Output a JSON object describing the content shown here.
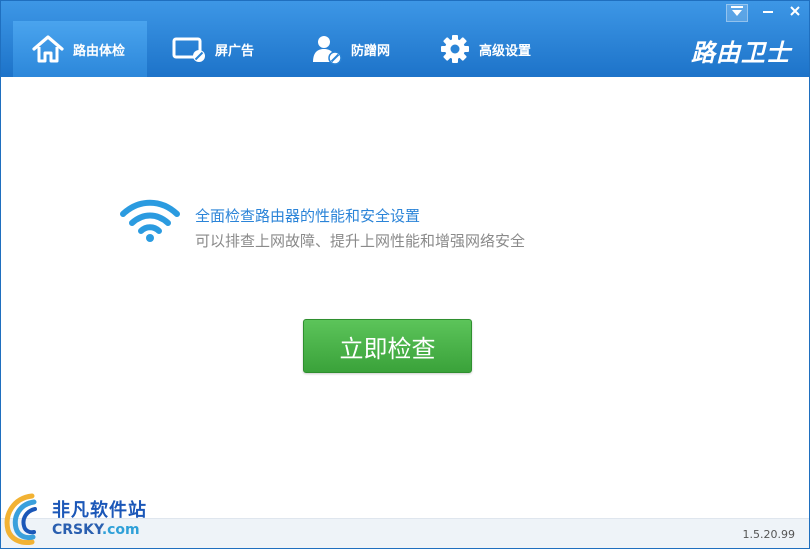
{
  "app": {
    "brand": "路由卫士"
  },
  "tabs": [
    {
      "label": "路由体检",
      "icon": "home-icon",
      "active": true
    },
    {
      "label": "屏广告",
      "icon": "screen-block-icon",
      "active": false
    },
    {
      "label": "防蹭网",
      "icon": "user-guard-icon",
      "active": false
    },
    {
      "label": "高级设置",
      "icon": "gear-icon",
      "active": false
    }
  ],
  "window_controls": {
    "menu": "menu-icon",
    "minimize": "minimize-icon",
    "close": "close-icon"
  },
  "main": {
    "icon": "wifi-icon",
    "headline": "全面检查路由器的性能和安全设置",
    "subline": "可以排查上网故障、提升上网性能和增强网络安全",
    "check_button": "立即检查"
  },
  "statusbar": {
    "version": "1.5.20.99"
  },
  "watermark": {
    "name_cn": "非凡软件站",
    "name_en": "CRSKY",
    "domain_suffix": ".com"
  },
  "colors": {
    "titlebar": "#2a84d6",
    "accent_text": "#2b84d8",
    "button_green": "#4ab44a",
    "muted_text": "#8a8a8a"
  }
}
